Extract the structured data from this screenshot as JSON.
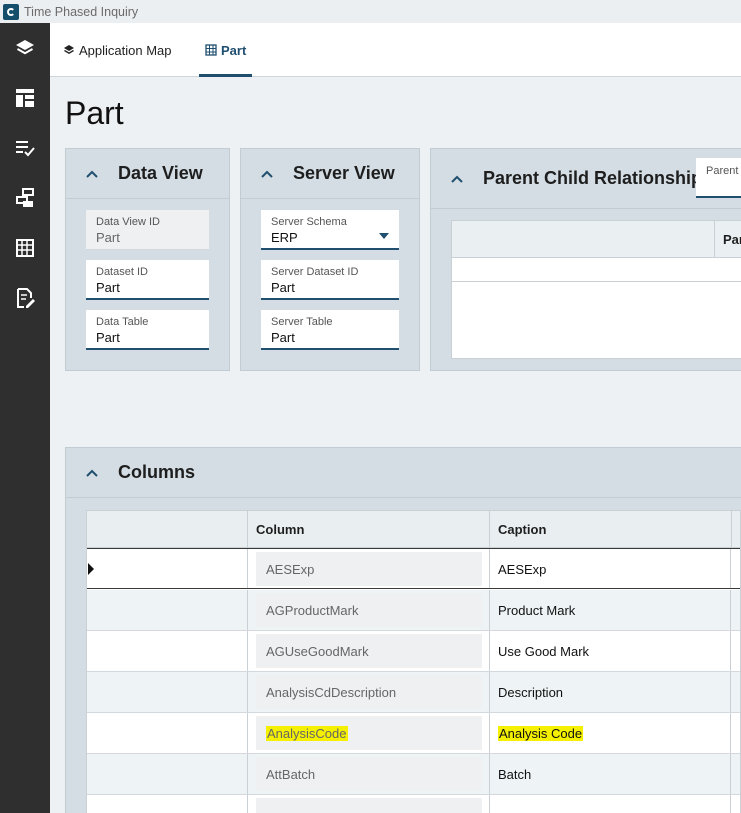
{
  "window": {
    "title": "Time Phased Inquiry"
  },
  "tabs": [
    {
      "label": "Application Map"
    },
    {
      "label": "Part"
    }
  ],
  "page": {
    "title": "Part"
  },
  "data_view": {
    "title": "Data View",
    "fields": [
      {
        "label": "Data View ID",
        "value": "Part"
      },
      {
        "label": "Dataset ID",
        "value": "Part"
      },
      {
        "label": "Data Table",
        "value": "Part"
      }
    ]
  },
  "server_view": {
    "title": "Server View",
    "fields": [
      {
        "label": "Server Schema",
        "value": "ERP"
      },
      {
        "label": "Server Dataset ID",
        "value": "Part"
      },
      {
        "label": "Server Table",
        "value": "Part"
      }
    ]
  },
  "relationships": {
    "title": "Parent Child Relationships",
    "tab_label": "Parent",
    "column_header": "Parent"
  },
  "columns_panel": {
    "title": "Columns",
    "headers": [
      "",
      "Column",
      "Caption"
    ],
    "rows": [
      {
        "column": "AESExp",
        "caption": "AESExp"
      },
      {
        "column": "AGProductMark",
        "caption": "Product Mark"
      },
      {
        "column": "AGUseGoodMark",
        "caption": "Use Good Mark"
      },
      {
        "column": "AnalysisCdDescription",
        "caption": "Description"
      },
      {
        "column": "AnalysisCode",
        "caption": "Analysis Code"
      },
      {
        "column": "AttBatch",
        "caption": "Batch"
      }
    ]
  },
  "colors": {
    "accent": "#1f4e6f",
    "highlight": "#f4f000",
    "rail": "#2f2f2f"
  }
}
